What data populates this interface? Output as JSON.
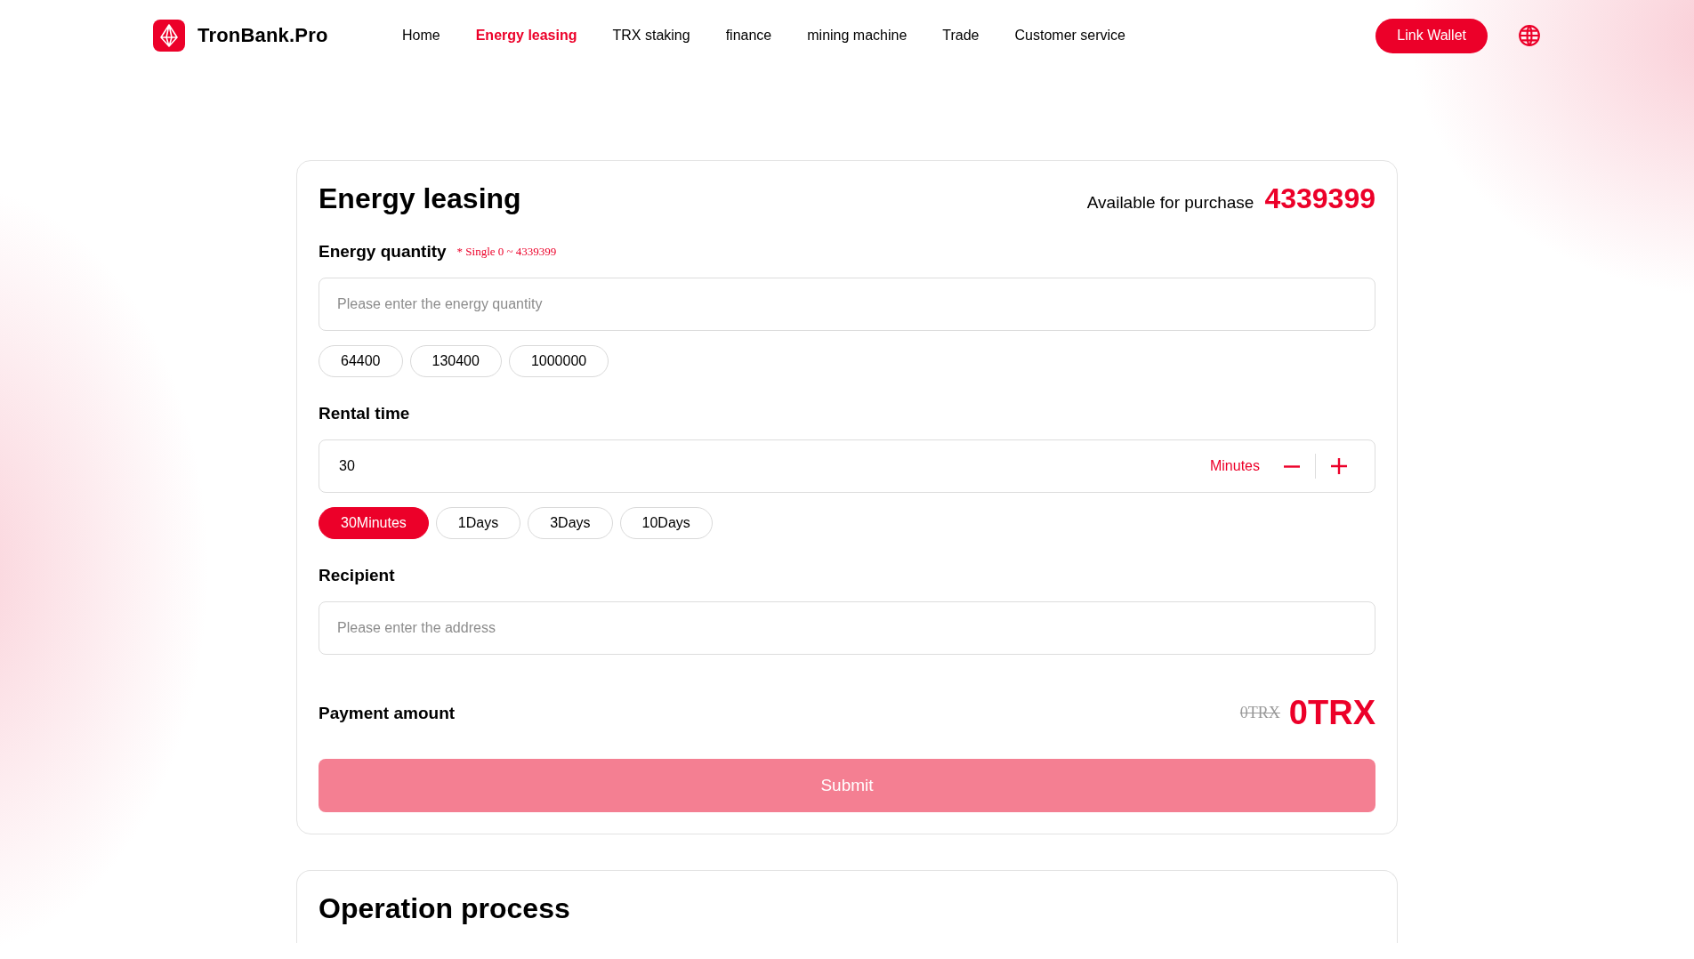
{
  "brand": {
    "name": "TronBank.Pro"
  },
  "nav": [
    {
      "label": "Home",
      "selected": false
    },
    {
      "label": "Energy leasing",
      "selected": true
    },
    {
      "label": "TRX staking",
      "selected": false
    },
    {
      "label": "finance",
      "selected": false
    },
    {
      "label": "mining machine",
      "selected": false
    },
    {
      "label": "Trade",
      "selected": false
    },
    {
      "label": "Customer service",
      "selected": false
    }
  ],
  "link_wallet": "Link Wallet",
  "form": {
    "title": "Energy leasing",
    "available_label": "Available for purchase",
    "available_value": "4339399",
    "quantity": {
      "label": "Energy quantity",
      "hint": "* Single 0 ~ 4339399",
      "placeholder": "Please enter the energy quantity",
      "presets": [
        {
          "label": "64400",
          "selected": false
        },
        {
          "label": "130400",
          "selected": false
        },
        {
          "label": "1000000",
          "selected": false
        }
      ]
    },
    "rental": {
      "label": "Rental time",
      "value": "30",
      "unit": "Minutes",
      "presets": [
        {
          "label": "30Minutes",
          "selected": true
        },
        {
          "label": "1Days",
          "selected": false
        },
        {
          "label": "3Days",
          "selected": false
        },
        {
          "label": "10Days",
          "selected": false
        }
      ]
    },
    "recipient": {
      "label": "Recipient",
      "placeholder": "Please enter the address"
    },
    "payment": {
      "label": "Payment amount",
      "original": "0TRX",
      "amount": "0TRX"
    },
    "submit": {
      "label": "Submit",
      "disabled": true
    }
  },
  "process": {
    "title": "Operation process"
  }
}
